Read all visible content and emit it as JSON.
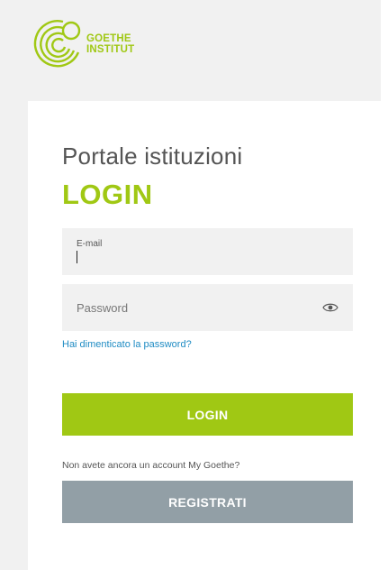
{
  "logo": {
    "line1": "GOETHE",
    "line2": "INSTITUT",
    "icon": "goethe-circles-icon",
    "color": "#a0c814"
  },
  "portal": {
    "title": "Portale istituzioni",
    "heading": "LOGIN"
  },
  "form": {
    "email_label": "E-mail",
    "email_value": "",
    "password_placeholder": "Password",
    "password_value": "",
    "show_password_icon": "eye-icon",
    "forgot_password": "Hai dimenticato la password?",
    "login_button": "LOGIN",
    "no_account_text": "Non avete ancora un account My Goethe?",
    "register_button": "REGISTRATI"
  },
  "colors": {
    "accent": "#a0c814",
    "link": "#1e8bc3",
    "secondary_button": "#929fa6",
    "field_background": "#f1f1f1"
  }
}
